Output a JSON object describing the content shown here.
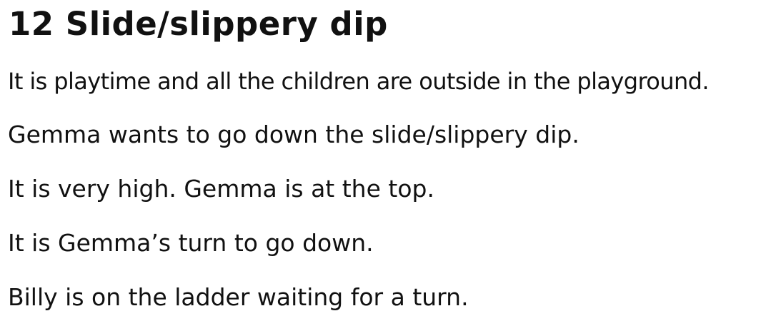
{
  "document": {
    "title": "12 Slide/slippery dip",
    "paragraphs": [
      "It is playtime and all the children are outside in the playground.",
      "Gemma wants to go down the slide/slippery dip.",
      "It is very high. Gemma is at the top.",
      "It is Gemma’s turn to go down.",
      "Billy is on the ladder waiting for a turn."
    ]
  }
}
